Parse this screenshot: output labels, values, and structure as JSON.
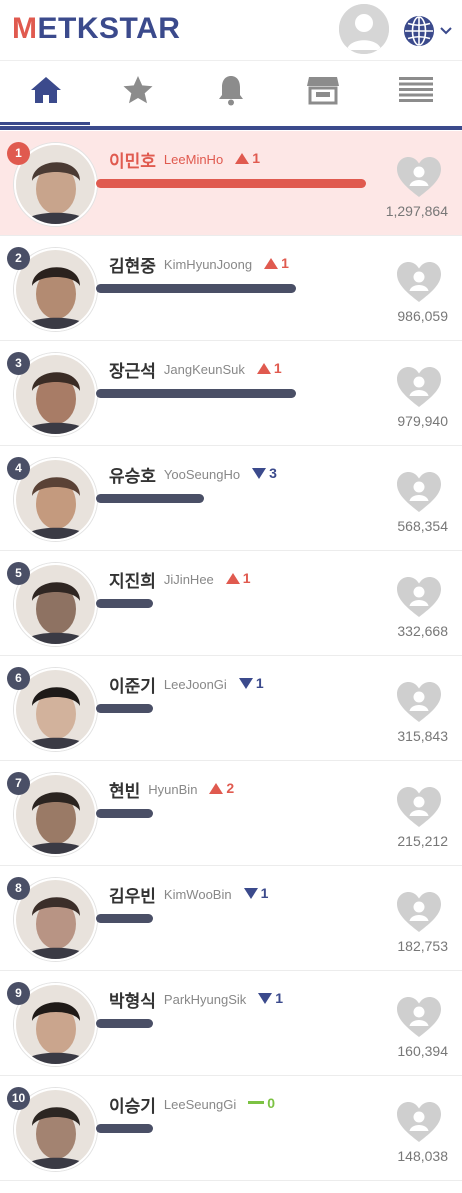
{
  "app": {
    "logo": {
      "accent": "M",
      "rest": "ETKSTAR"
    },
    "colors": {
      "brand": "#3b4a8c",
      "accent": "#e05a4f",
      "same": "#7cc243"
    },
    "icons": {
      "profile": "user-avatar-icon",
      "language": "globe-icon"
    }
  },
  "tabs": [
    {
      "name": "home",
      "icon": "home-icon",
      "active": true
    },
    {
      "name": "favorites",
      "icon": "star-icon",
      "active": false
    },
    {
      "name": "notifications",
      "icon": "bell-icon",
      "active": false
    },
    {
      "name": "store",
      "icon": "store-icon",
      "active": false
    },
    {
      "name": "menu",
      "icon": "list-icon",
      "active": false
    }
  ],
  "ranking": [
    {
      "rank": "1",
      "korean": "이민호",
      "english": "LeeMinHo",
      "direction": "up",
      "change": "1",
      "bar": 1.0,
      "votes": "1,297,864"
    },
    {
      "rank": "2",
      "korean": "김현중",
      "english": "KimHyunJoong",
      "direction": "up",
      "change": "1",
      "bar": 0.74,
      "votes": "986,059"
    },
    {
      "rank": "3",
      "korean": "장근석",
      "english": "JangKeunSuk",
      "direction": "up",
      "change": "1",
      "bar": 0.74,
      "votes": "979,940"
    },
    {
      "rank": "4",
      "korean": "유승호",
      "english": "YooSeungHo",
      "direction": "down",
      "change": "3",
      "bar": 0.4,
      "votes": "568,354"
    },
    {
      "rank": "5",
      "korean": "지진희",
      "english": "JiJinHee",
      "direction": "up",
      "change": "1",
      "bar": 0.21,
      "votes": "332,668"
    },
    {
      "rank": "6",
      "korean": "이준기",
      "english": "LeeJoonGi",
      "direction": "down",
      "change": "1",
      "bar": 0.21,
      "votes": "315,843"
    },
    {
      "rank": "7",
      "korean": "현빈",
      "english": "HyunBin",
      "direction": "up",
      "change": "2",
      "bar": 0.21,
      "votes": "215,212"
    },
    {
      "rank": "8",
      "korean": "김우빈",
      "english": "KimWooBin",
      "direction": "down",
      "change": "1",
      "bar": 0.21,
      "votes": "182,753"
    },
    {
      "rank": "9",
      "korean": "박형식",
      "english": "ParkHyungSik",
      "direction": "down",
      "change": "1",
      "bar": 0.21,
      "votes": "160,394"
    },
    {
      "rank": "10",
      "korean": "이승기",
      "english": "LeeSeungGi",
      "direction": "same",
      "change": "0",
      "bar": 0.21,
      "votes": "148,038"
    }
  ]
}
